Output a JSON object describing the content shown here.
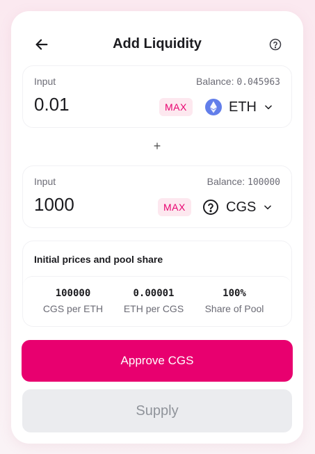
{
  "header": {
    "title": "Add Liquidity",
    "back_icon": "arrow-left-icon",
    "help_icon": "question-circle-icon"
  },
  "inputs": [
    {
      "label": "Input",
      "balance_label": "Balance:",
      "balance_value": "0.045963",
      "amount": "0.01",
      "max_label": "MAX",
      "token": "ETH",
      "token_icon": "eth-logo-icon"
    },
    {
      "label": "Input",
      "balance_label": "Balance:",
      "balance_value": "100000",
      "amount": "1000",
      "max_label": "MAX",
      "token": "CGS",
      "token_icon": "question-circle-icon"
    }
  ],
  "plus": "+",
  "prices": {
    "title": "Initial prices and pool share",
    "stats": [
      {
        "value": "100000",
        "label": "CGS per ETH"
      },
      {
        "value": "0.00001",
        "label": "ETH per CGS"
      },
      {
        "value": "100%",
        "label": "Share of Pool"
      }
    ]
  },
  "buttons": {
    "approve": "Approve CGS",
    "supply": "Supply"
  },
  "colors": {
    "accent": "#e8006f",
    "accent_soft": "#fde8ef",
    "eth": "#627eea",
    "disabled_bg": "#ebecef"
  }
}
